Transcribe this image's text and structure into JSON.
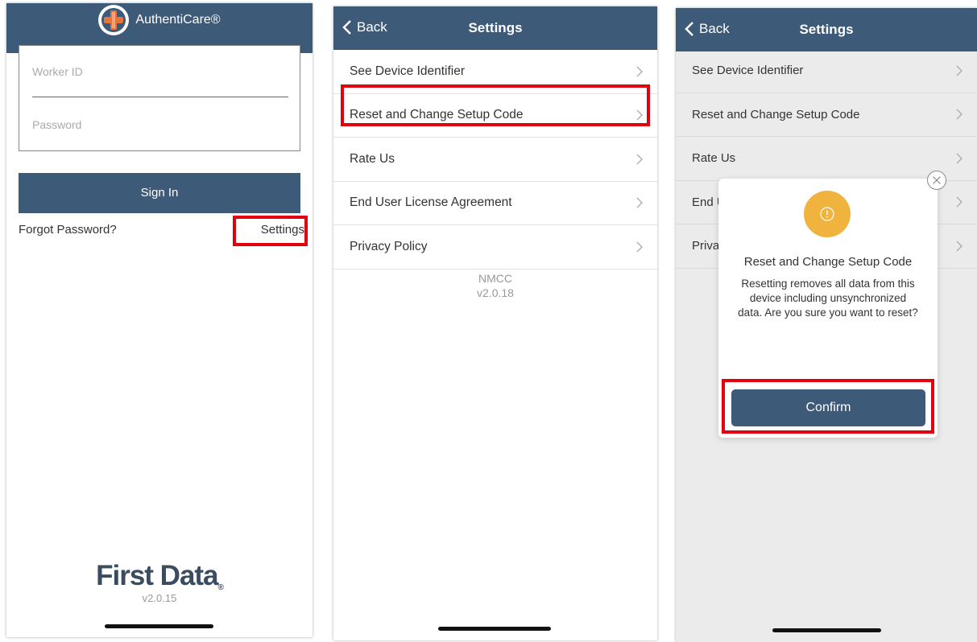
{
  "login_screen": {
    "app_name": "AuthentiCare®",
    "worker_id_placeholder": "Worker ID",
    "password_placeholder": "Password",
    "sign_in_label": "Sign In",
    "forgot_password_label": "Forgot Password?",
    "settings_label": "Settings",
    "footer_logo_text": "First Data",
    "footer_logo_mark": "®",
    "version": "v2.0.15"
  },
  "settings_screen": {
    "back_label": "Back",
    "title": "Settings",
    "items": [
      {
        "label": "See Device Identifier"
      },
      {
        "label": "Reset and Change Setup Code"
      },
      {
        "label": "Rate Us"
      },
      {
        "label": "End User License Agreement"
      },
      {
        "label": "Privacy Policy"
      }
    ],
    "org": "NMCC",
    "version": "v2.0.18"
  },
  "confirm_screen": {
    "back_label": "Back",
    "title": "Settings",
    "items": [
      {
        "label": "See Device Identifier"
      },
      {
        "label": "Reset and Change Setup Code"
      },
      {
        "label": "Rate Us"
      },
      {
        "label": "End U"
      },
      {
        "label": "Priva"
      }
    ],
    "modal": {
      "title": "Reset and Change Setup Code",
      "body": "Resetting removes all data from this device including unsynchronized data. Are you sure you want to reset?",
      "confirm_label": "Confirm"
    }
  },
  "colors": {
    "navbar": "#3d5a78",
    "highlight": "#e3000f",
    "warning": "#f0b33d"
  }
}
